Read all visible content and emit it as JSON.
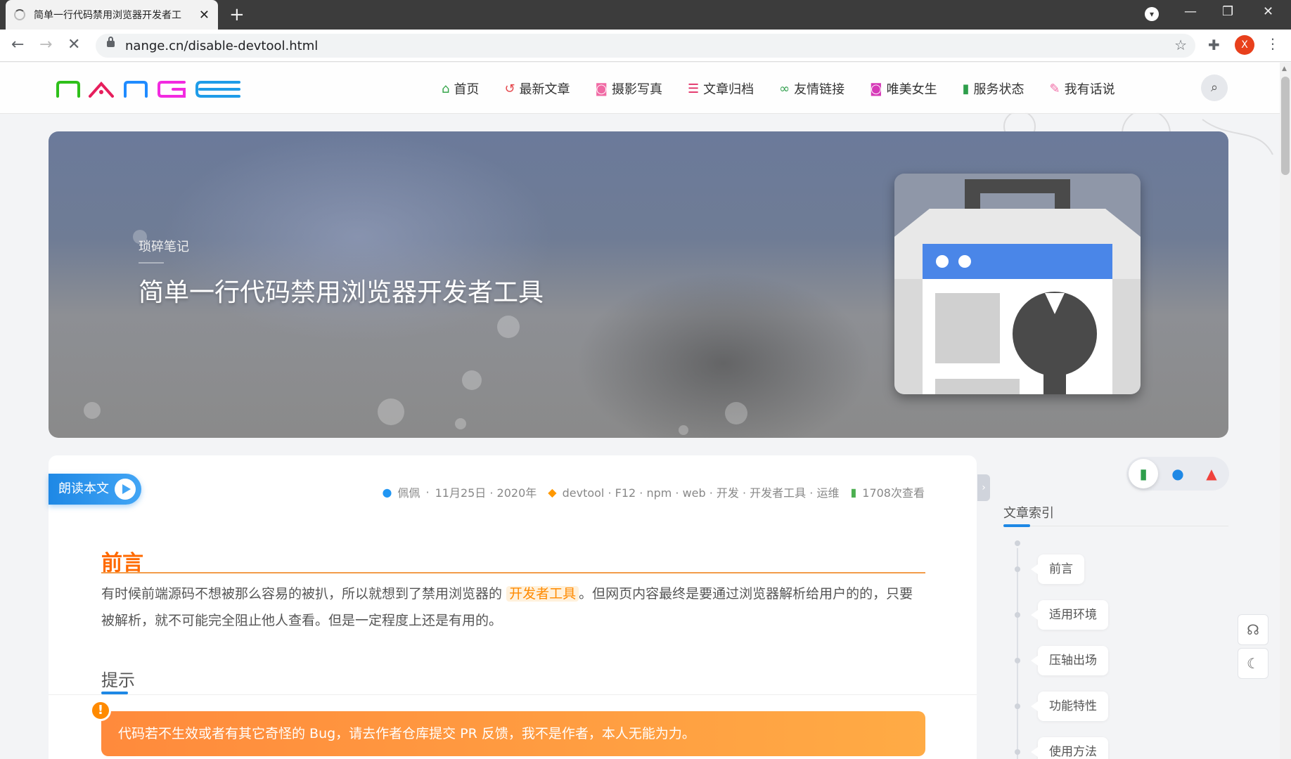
{
  "browser": {
    "tab_title": "简单一行代码禁用浏览器开发者工具 - 南",
    "tab_close": "✕",
    "new_tab": "+",
    "url": "nange.cn/disable-devtool.html",
    "icons": {
      "back": "arrow-left-icon",
      "forward": "arrow-right-icon",
      "reload": "stop-icon",
      "star": "star-icon",
      "extensions": "puzzle-icon",
      "menu": "kebab-menu-icon"
    },
    "profile_letter": "X",
    "window_controls": {
      "minimize": "—",
      "restore": "❐",
      "close": "✕"
    },
    "download_glyph": "▾"
  },
  "site": {
    "logo_letters": [
      "N",
      "A",
      "N",
      "G",
      "E"
    ],
    "logo_colors": [
      "#2ec01a",
      "#e61e5c",
      "#1f8bff",
      "#f22ae0",
      "#1e9ce8"
    ],
    "nav": [
      {
        "label": "首页",
        "icon": "home-icon",
        "glyph": "⌂",
        "color": "#35a54a"
      },
      {
        "label": "最新文章",
        "icon": "history-icon",
        "glyph": "↺",
        "color": "#e5484d"
      },
      {
        "label": "摄影写真",
        "icon": "camera-icon",
        "glyph": "◙",
        "color": "#f06aa4"
      },
      {
        "label": "文章归档",
        "icon": "list-icon",
        "glyph": "☰",
        "color": "#e0245e"
      },
      {
        "label": "友情链接",
        "icon": "link-icon",
        "glyph": "∞",
        "color": "#2e9e4b"
      },
      {
        "label": "唯美女生",
        "icon": "camera-retro-icon",
        "glyph": "◙",
        "color": "#d63ab8"
      },
      {
        "label": "服务状态",
        "icon": "signal-icon",
        "glyph": "▮",
        "color": "#2e9e4b"
      },
      {
        "label": "我有话说",
        "icon": "feather-icon",
        "glyph": "✎",
        "color": "#f06aa4"
      }
    ],
    "search_glyph": "⌕"
  },
  "hero": {
    "category": "琐碎笔记",
    "title": "简单一行代码禁用浏览器开发者工具",
    "image_icon": "devtools-toolbox-icon"
  },
  "article": {
    "read_button": "朗读本文",
    "meta": {
      "author": "佩佩",
      "date": "11月25日 · 2020年",
      "tags": "devtool · F12 · npm · web · 开发 · 开发者工具 · 运维",
      "views": "1708次查看",
      "icons": {
        "author": "user-icon",
        "tags": "tag-icon",
        "views": "views-icon"
      }
    },
    "heading_preface": "前言",
    "para_before": "有时候前端源码不想被那么容易的被扒，所以就想到了禁用浏览器的",
    "para_highlight": "开发者工具",
    "para_after": "。但网页内容最终是要通过浏览器解析给用户的的，只要被解析，就不可能完全阻止他人查看。但是一定程度上还是有用的。",
    "heading_tip": "提示",
    "warning": "代码若不生效或者有其它奇怪的 Bug，请去作者仓库提交 PR 反馈，我不是作者，本人无能为力。",
    "warning_glyph": "!"
  },
  "sidebar": {
    "tabs": [
      {
        "icon": "bookmark-icon",
        "glyph": "▮",
        "color": "#2e9e4b",
        "active": true
      },
      {
        "icon": "user-icon",
        "glyph": "●",
        "color": "#1e88e5",
        "active": false
      },
      {
        "icon": "fire-icon",
        "glyph": "▲",
        "color": "#f0413c",
        "active": false
      }
    ],
    "toc_title": "文章索引",
    "toc": [
      "前言",
      "适用环境",
      "压轴出场",
      "功能特性",
      "使用方法"
    ]
  },
  "floating": {
    "support_icon": "headset-icon",
    "support_glyph": "☊",
    "theme_icon": "moon-icon",
    "theme_glyph": "☾"
  },
  "collapse_glyph": "›"
}
